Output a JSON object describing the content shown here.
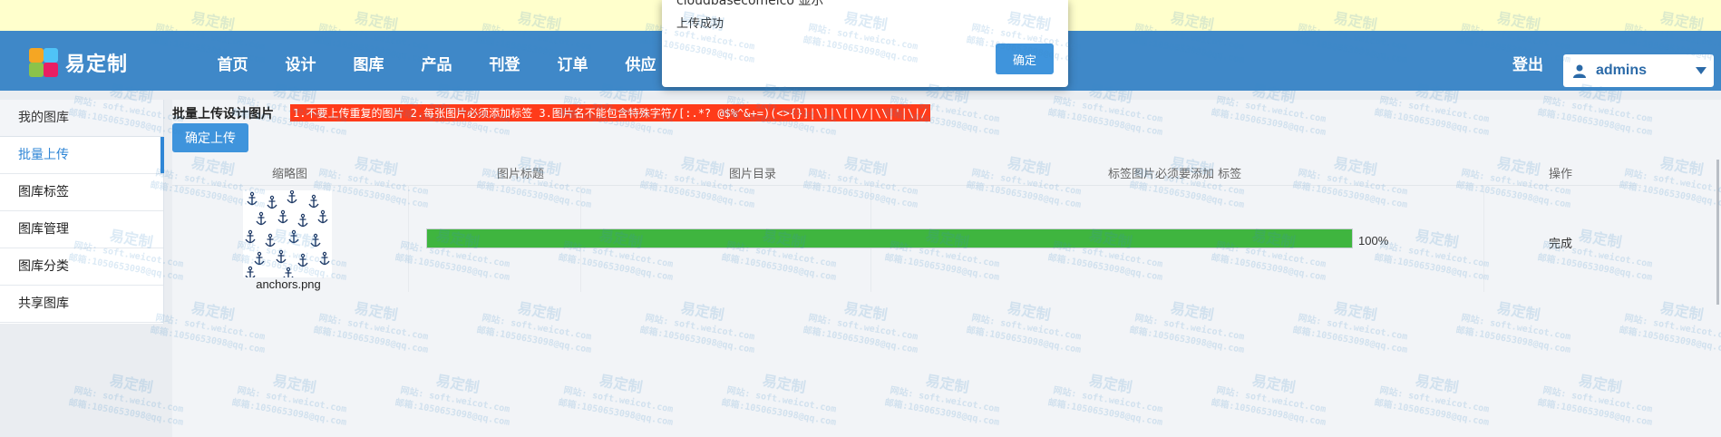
{
  "dialog": {
    "title_partial": "cloudbasecomelco 显示",
    "message": "上传成功",
    "ok_label": "确定"
  },
  "header": {
    "logo_text": "易定制",
    "nav": [
      "首页",
      "设计",
      "图库",
      "产品",
      "刊登",
      "订单",
      "供应"
    ],
    "logout_label": "登出",
    "username": "admins"
  },
  "sidebar": {
    "header": "我的图库",
    "items": [
      {
        "label": "批量上传",
        "active": true
      },
      {
        "label": "图库标签",
        "active": false
      },
      {
        "label": "图库管理",
        "active": false
      },
      {
        "label": "图库分类",
        "active": false
      },
      {
        "label": "共享图库",
        "active": false
      }
    ]
  },
  "main": {
    "title": "批量上传设计图片",
    "warning": "1.不要上传重复的图片 2.每张图片必须添加标签 3.图片名不能包含特殊字符/[:.*? @$%^&+=)(<>{}]|\\]|\\[|\\/|\\\\|'|\\|/",
    "confirm_upload_label": "确定上传",
    "table": {
      "columns": [
        "缩略图",
        "图片标题",
        "图片目录",
        "标签图片必须要添加  标签",
        "操作"
      ],
      "rows": [
        {
          "filename": "anchors.png",
          "progress": 1.0,
          "progress_text": "100%",
          "status": "完成"
        }
      ]
    }
  },
  "watermark": {
    "brand": "易定制",
    "site": "网站: soft.weicot.com",
    "email": "邮箱:1050653098@qq.com"
  },
  "colors": {
    "topbar": "#3f88c8",
    "accent": "#2f86d6",
    "progress": "#3fb53f",
    "warning_bg": "#ff3b1a"
  }
}
